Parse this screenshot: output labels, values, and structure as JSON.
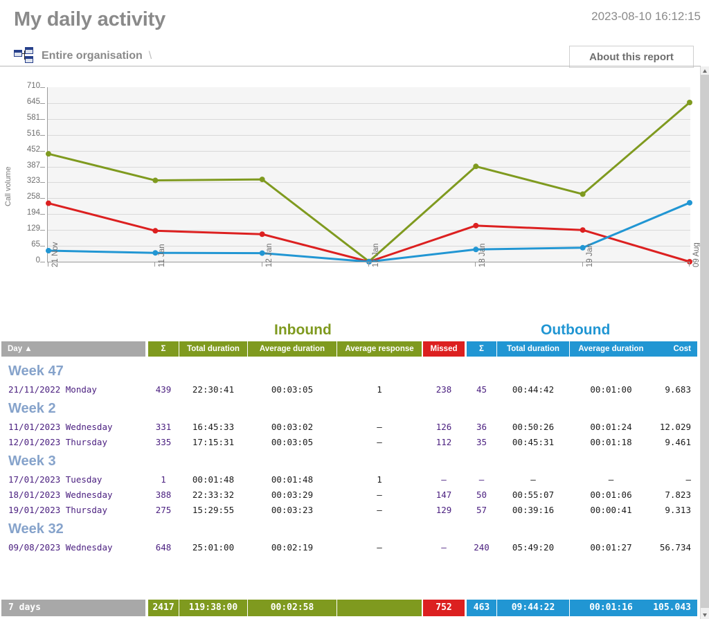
{
  "header": {
    "title": "My daily activity",
    "timestamp": "2023-08-10 16:12:15",
    "org_icon": "org-chart-icon",
    "org_label": "Entire organisation",
    "org_separator": "\\",
    "about_button": "About this report"
  },
  "chart_data": {
    "type": "line",
    "title": "",
    "xlabel": "",
    "ylabel": "Call volume",
    "ylim": [
      0,
      710
    ],
    "grid": true,
    "legend": "none",
    "yticks": [
      0,
      65,
      129,
      194,
      258,
      323,
      387,
      452,
      516,
      581,
      645,
      710
    ],
    "categories": [
      "21 Nov",
      "11 Jan",
      "12 Jan",
      "17 Jan",
      "18 Jan",
      "19 Jan",
      "09 Aug"
    ],
    "series": [
      {
        "name": "Inbound",
        "color": "#7f9a1f",
        "values": [
          439,
          331,
          335,
          1,
          388,
          275,
          648
        ]
      },
      {
        "name": "Missed",
        "color": "#dc2020",
        "values": [
          238,
          126,
          112,
          0,
          147,
          129,
          0
        ]
      },
      {
        "name": "Outbound",
        "color": "#2196d3",
        "values": [
          45,
          36,
          35,
          0,
          50,
          57,
          240
        ]
      }
    ]
  },
  "sections": {
    "inbound": "Inbound",
    "outbound": "Outbound"
  },
  "table": {
    "columns": [
      {
        "key": "day",
        "label": "Day ▲",
        "group": "day",
        "align": "left"
      },
      {
        "key": "in_sum",
        "label": "Σ",
        "group": "inbound",
        "align": "center"
      },
      {
        "key": "in_total",
        "label": "Total duration",
        "group": "inbound",
        "align": "center"
      },
      {
        "key": "in_avg",
        "label": "Average duration",
        "group": "inbound",
        "align": "center"
      },
      {
        "key": "in_resp",
        "label": "Average response",
        "group": "inbound",
        "align": "center"
      },
      {
        "key": "missed",
        "label": "Missed",
        "group": "missed",
        "align": "center"
      },
      {
        "key": "out_sum",
        "label": "Σ",
        "group": "outbound",
        "align": "center"
      },
      {
        "key": "out_total",
        "label": "Total duration",
        "group": "outbound",
        "align": "center"
      },
      {
        "key": "out_avg",
        "label": "Average duration",
        "group": "outbound",
        "align": "center"
      },
      {
        "key": "cost",
        "label": "Cost",
        "group": "outbound",
        "align": "right"
      }
    ],
    "groups": [
      {
        "week": "Week 47",
        "rows": [
          {
            "date": "21/11/2022",
            "weekday": "Monday",
            "in_sum": "439",
            "in_total": "22:30:41",
            "in_avg": "00:03:05",
            "in_resp": "1",
            "missed": "238",
            "out_sum": "45",
            "out_total": "00:44:42",
            "out_avg": "00:01:00",
            "cost": "9.683"
          }
        ]
      },
      {
        "week": "Week 2",
        "rows": [
          {
            "date": "11/01/2023",
            "weekday": "Wednesday",
            "in_sum": "331",
            "in_total": "16:45:33",
            "in_avg": "00:03:02",
            "in_resp": "–",
            "missed": "126",
            "out_sum": "36",
            "out_total": "00:50:26",
            "out_avg": "00:01:24",
            "cost": "12.029"
          },
          {
            "date": "12/01/2023",
            "weekday": "Thursday",
            "in_sum": "335",
            "in_total": "17:15:31",
            "in_avg": "00:03:05",
            "in_resp": "–",
            "missed": "112",
            "out_sum": "35",
            "out_total": "00:45:31",
            "out_avg": "00:01:18",
            "cost": "9.461"
          }
        ]
      },
      {
        "week": "Week 3",
        "rows": [
          {
            "date": "17/01/2023",
            "weekday": "Tuesday",
            "in_sum": "1",
            "in_total": "00:01:48",
            "in_avg": "00:01:48",
            "in_resp": "1",
            "missed": "–",
            "out_sum": "–",
            "out_total": "–",
            "out_avg": "–",
            "cost": "–"
          },
          {
            "date": "18/01/2023",
            "weekday": "Wednesday",
            "in_sum": "388",
            "in_total": "22:33:32",
            "in_avg": "00:03:29",
            "in_resp": "–",
            "missed": "147",
            "out_sum": "50",
            "out_total": "00:55:07",
            "out_avg": "00:01:06",
            "cost": "7.823"
          },
          {
            "date": "19/01/2023",
            "weekday": "Thursday",
            "in_sum": "275",
            "in_total": "15:29:55",
            "in_avg": "00:03:23",
            "in_resp": "–",
            "missed": "129",
            "out_sum": "57",
            "out_total": "00:39:16",
            "out_avg": "00:00:41",
            "cost": "9.313"
          }
        ]
      },
      {
        "week": "Week 32",
        "rows": [
          {
            "date": "09/08/2023",
            "weekday": "Wednesday",
            "in_sum": "648",
            "in_total": "25:01:00",
            "in_avg": "00:02:19",
            "in_resp": "–",
            "missed": "–",
            "out_sum": "240",
            "out_total": "05:49:20",
            "out_avg": "00:01:27",
            "cost": "56.734"
          }
        ]
      }
    ],
    "total": {
      "day": "7 days",
      "in_sum": "2417",
      "in_total": "119:38:00",
      "in_avg": "00:02:58",
      "in_resp": "",
      "missed": "752",
      "out_sum": "463",
      "out_total": "09:44:22",
      "out_avg": "00:01:16",
      "cost": "105.043"
    }
  },
  "colors": {
    "inbound": "#7f9a1f",
    "outbound": "#2196d3",
    "missed": "#dc2020",
    "day_header": "#a8a8a8",
    "week_label": "#86a3cb",
    "value_purple": "#4b2080"
  },
  "scrollbar": {
    "up_arrow": "scroll-up-arrow-icon",
    "down_arrow": "scroll-down-arrow-icon"
  }
}
